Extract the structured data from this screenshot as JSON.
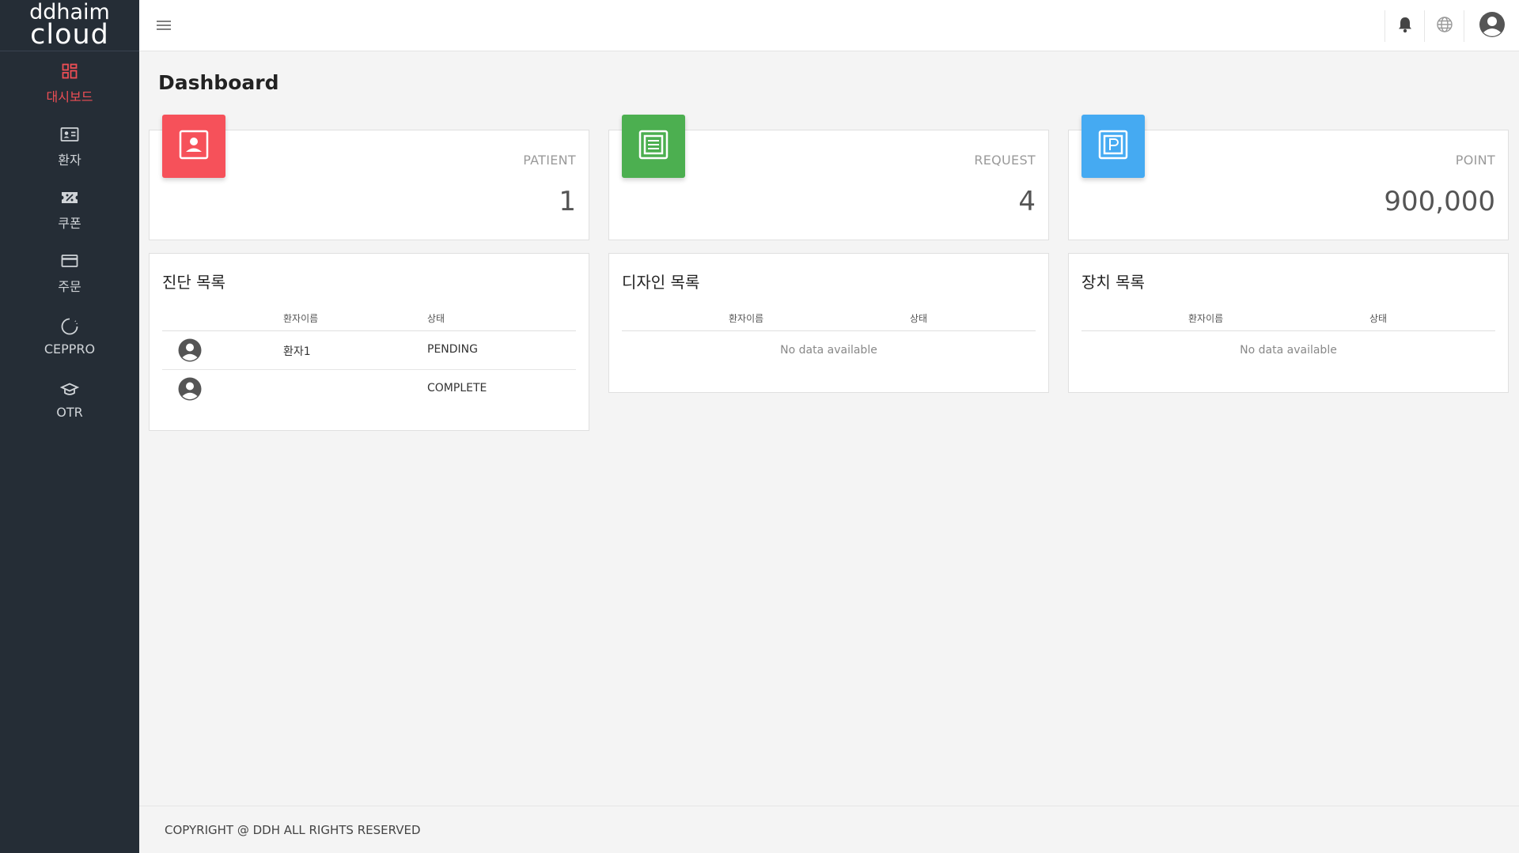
{
  "logo": {
    "line1": "ddhaim",
    "line2": "cloud"
  },
  "sidebar": {
    "items": [
      {
        "label": "대시보드",
        "icon": "dashboard-icon",
        "active": true
      },
      {
        "label": "환자",
        "icon": "patient-card-icon",
        "active": false
      },
      {
        "label": "쿠폰",
        "icon": "coupon-icon",
        "active": false
      },
      {
        "label": "주문",
        "icon": "credit-card-icon",
        "active": false
      },
      {
        "label": "CEPPRO",
        "icon": "loading-circle-icon",
        "active": false
      },
      {
        "label": "OTR",
        "icon": "graduation-cap-icon",
        "active": false
      }
    ]
  },
  "header": {
    "menu_icon": "hamburger-menu-icon",
    "notification_icon": "bell-icon",
    "language_icon": "globe-icon",
    "profile_icon": "user-avatar-icon"
  },
  "page": {
    "title": "Dashboard"
  },
  "stats": [
    {
      "label": "PATIENT",
      "value": "1",
      "color": "#f6515a",
      "icon": "person-badge-icon"
    },
    {
      "label": "REQUEST",
      "value": "4",
      "color": "#4caf50",
      "icon": "document-icon"
    },
    {
      "label": "POINT",
      "value": "900,000",
      "color": "#45aaf2",
      "icon": "point-p-icon"
    }
  ],
  "diagnosis": {
    "title": "진단 목록",
    "col_name": "환자이름",
    "col_status": "상태",
    "rows": [
      {
        "name": "환자1",
        "status": "PENDING"
      },
      {
        "name": "",
        "status": "COMPLETE"
      }
    ]
  },
  "design": {
    "title": "디자인 목록",
    "col_name": "환자이름",
    "col_status": "상태",
    "empty": "No data available"
  },
  "device": {
    "title": "장치 목록",
    "col_name": "환자이름",
    "col_status": "상태",
    "empty": "No data available"
  },
  "footer": {
    "text": "COPYRIGHT @ DDH ALL RIGHTS RESERVED"
  },
  "colors": {
    "sidebar_bg": "#252d36",
    "active": "#ef4e55",
    "page_bg": "#f4f4f4"
  }
}
